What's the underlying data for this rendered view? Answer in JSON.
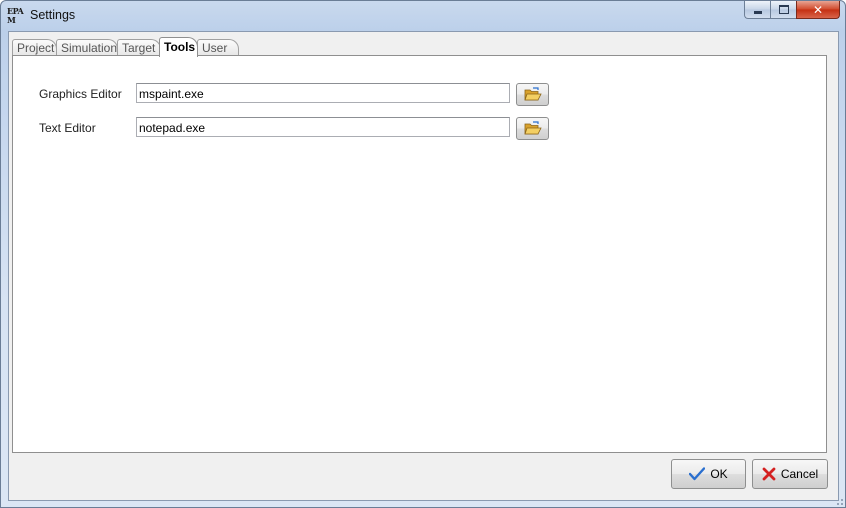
{
  "window": {
    "title": "Settings",
    "app_icon_text": "EPAM",
    "controls": {
      "minimize": "minimize-icon",
      "maximize": "maximize-icon",
      "close": "close-icon"
    }
  },
  "tabs": [
    {
      "label": "Project",
      "active": false
    },
    {
      "label": "Simulation",
      "active": false
    },
    {
      "label": "Target",
      "active": false
    },
    {
      "label": "Tools",
      "active": true
    },
    {
      "label": "User",
      "active": false
    }
  ],
  "tools": {
    "graphics_editor": {
      "label": "Graphics Editor",
      "value": "mspaint.exe",
      "browse_icon": "folder-open-icon"
    },
    "text_editor": {
      "label": "Text Editor",
      "value": "notepad.exe",
      "browse_icon": "folder-open-icon"
    }
  },
  "buttons": {
    "ok": {
      "label": "OK",
      "icon": "checkmark-icon"
    },
    "cancel": {
      "label": "Cancel",
      "icon": "x-icon"
    }
  },
  "colors": {
    "check": "#2a6fcf",
    "cancel_x": "#d42020",
    "folder": "#e9b43c"
  }
}
